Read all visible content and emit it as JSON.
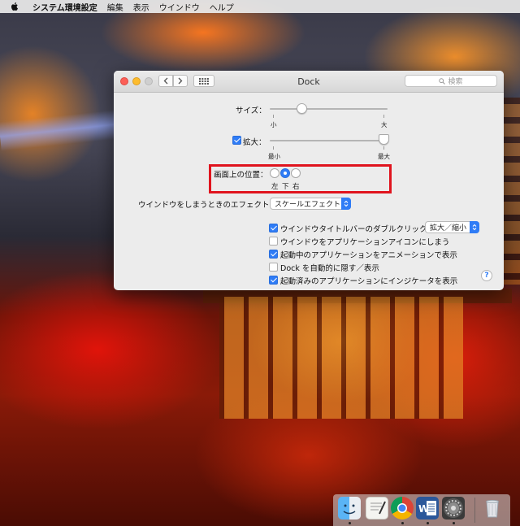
{
  "menubar": {
    "apple_icon": "apple-logo-icon",
    "app_name": "システム環境設定",
    "items": [
      "編集",
      "表示",
      "ウインドウ",
      "ヘルプ"
    ]
  },
  "window": {
    "title": "Dock",
    "search_placeholder": "検索"
  },
  "dock_prefs": {
    "size": {
      "label": "サイズ：",
      "min_label": "小",
      "max_label": "大",
      "level": 0.25
    },
    "magnification": {
      "label": "拡大：",
      "checked": true,
      "min_label": "最小",
      "max_label": "最大",
      "level": 1.0
    },
    "position": {
      "label": "画面上の位置：",
      "options": [
        "左",
        "下",
        "右"
      ],
      "selected": "下"
    },
    "minimize_effect": {
      "label": "ウインドウをしまうときのエフェクト：",
      "value": "スケールエフェクト"
    },
    "checkboxes": [
      {
        "label": "ウインドウタイトルバーのダブルクリックで",
        "checked": true
      },
      {
        "label": "ウインドウをアプリケーションアイコンにしまう",
        "checked": false
      },
      {
        "label": "起動中のアプリケーションをアニメーションで表示",
        "checked": true
      },
      {
        "label": "Dock を自動的に隠す／表示",
        "checked": false
      },
      {
        "label": "起動済みのアプリケーションにインジケータを表示",
        "checked": true
      }
    ],
    "double_click_action": "拡大／縮小",
    "help": "?"
  },
  "dock": {
    "apps": [
      "finder-icon",
      "textedit-icon",
      "chrome-icon",
      "word-icon",
      "system-preferences-icon"
    ],
    "trash": "trash-icon"
  },
  "colors": {
    "accent": "#2f7cf6",
    "highlight_box": "#e0141e"
  }
}
